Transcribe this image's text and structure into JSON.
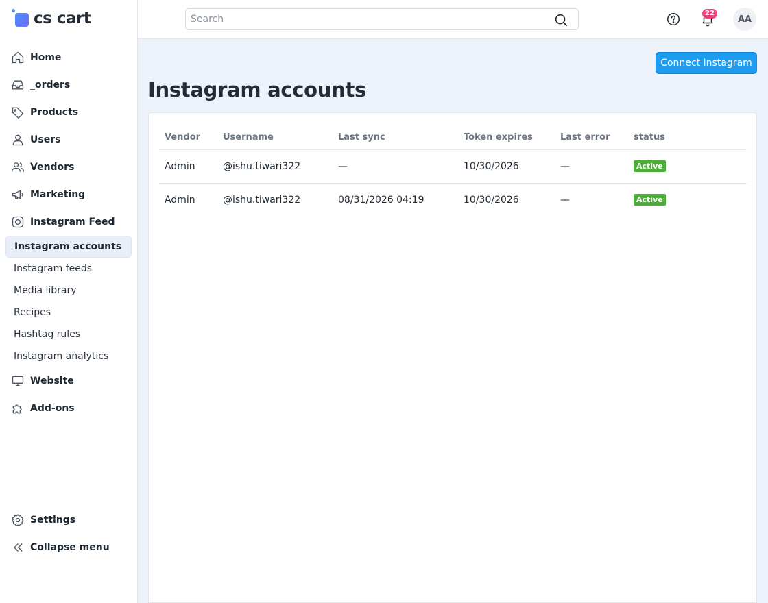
{
  "app": {
    "logo_text": "cs cart"
  },
  "sidebar": {
    "items": [
      {
        "label": "Home",
        "icon": "home-icon"
      },
      {
        "label": "_orders",
        "icon": "inbox-icon"
      },
      {
        "label": "Products",
        "icon": "tag-icon"
      },
      {
        "label": "Users",
        "icon": "user-icon"
      },
      {
        "label": "Vendors",
        "icon": "users-icon"
      },
      {
        "label": "Marketing",
        "icon": "megaphone-icon"
      },
      {
        "label": "Instagram Feed",
        "icon": "instagram-icon"
      }
    ],
    "subitems": [
      {
        "label": "Instagram accounts",
        "active": true
      },
      {
        "label": "Instagram feeds",
        "active": false
      },
      {
        "label": "Media library",
        "active": false
      },
      {
        "label": "Recipes",
        "active": false
      },
      {
        "label": "Hashtag rules",
        "active": false
      },
      {
        "label": "Instagram analytics",
        "active": false
      }
    ],
    "items_after": [
      {
        "label": "Website",
        "icon": "monitor-icon"
      },
      {
        "label": "Add-ons",
        "icon": "puzzle-icon"
      }
    ],
    "bottom": [
      {
        "label": "Settings",
        "icon": "gear-icon"
      },
      {
        "label": "Collapse menu",
        "icon": "chevrons-left-icon"
      }
    ]
  },
  "topbar": {
    "search_placeholder": "Search",
    "notification_count": "22",
    "avatar_initials": "AA"
  },
  "main": {
    "title": "Instagram accounts",
    "connect_button": "Connect Instagram",
    "table": {
      "headers": [
        "Vendor",
        "Username",
        "Last sync",
        "Token expires",
        "Last error",
        "status"
      ],
      "rows": [
        [
          "Admin",
          "@ishu.tiwari322",
          "—",
          "10/30/2026",
          "—",
          "Active"
        ],
        [
          "Admin",
          "@ishu.tiwari322",
          "08/31/2026 04:19",
          "10/30/2026",
          "—",
          "Active"
        ]
      ]
    }
  },
  "colors": {
    "accent": "#1e9cf0",
    "status_active": "#4cae36",
    "badge": "#e8467c",
    "active_nav_bg": "#e9eff8"
  }
}
